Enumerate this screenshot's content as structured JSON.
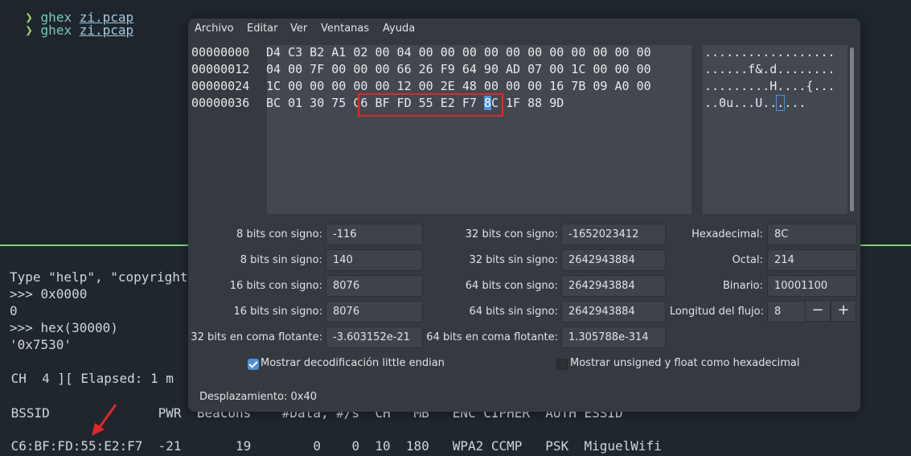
{
  "terminal": {
    "top_lines": [
      {
        "arrow": "❯",
        "cmd": "ghex",
        "file": "zi.pcap"
      }
    ],
    "partial_top_line": "❯ ghex zi.pcap",
    "python": [
      "Type \"help\", \"copyright\"",
      ">>> 0x0000",
      "0",
      ">>> hex(30000)",
      "'0x7530'"
    ],
    "airodump_status": " CH  4 ][ Elapsed: 1 m",
    "header_row": " BSSID              PWR  Beacons    #Data, #/s  CH   MB   ENC CIPHER  AUTH ESSID",
    "data_row": " C6:BF:FD:55:E2:F7  -21       19        0    0  10  180   WPA2 CCMP   PSK  MiguelWifi",
    "colors": {
      "prompt": "#9fd36f",
      "divider": "#7fd37a",
      "annotation": "#e2262a"
    }
  },
  "ghex": {
    "menu": [
      "Archivo",
      "Editar",
      "Ver",
      "Ventanas",
      "Ayuda"
    ],
    "rows": [
      {
        "offset": "00000000",
        "hex": "D4 C3 B2 A1 02 00 04 00 00 00 00 00 00 00 00 00 00 00",
        "ascii": ".................."
      },
      {
        "offset": "00000012",
        "hex": "04 00 7F 00 00 00 66 26 F9 64 90 AD 07 00 1C 00 00 00",
        "ascii": "......f&.d........"
      },
      {
        "offset": "00000024",
        "hex": "1C 00 00 00 00 00 12 00 2E 48 00 00 00 16 7B 09 A0 00",
        "ascii": ".........H....{..."
      },
      {
        "offset": "00000036",
        "hex_before": "BC 01 30 75 C6 BF FD 55 E2 F7 ",
        "hex_cursor": "8",
        "hex_after": "C 1F 88 9D",
        "ascii_before": "..0u...U..",
        "ascii_cursor": ".",
        "ascii_after": "..."
      }
    ],
    "fields": {
      "s8_label": "8 bits con signo:",
      "s8": "-116",
      "u8_label": "8 bits sin signo:",
      "u8": "140",
      "s16_label": "16 bits con signo:",
      "s16": "8076",
      "u16_label": "16 bits sin signo:",
      "u16": "8076",
      "f32_label": "32 bits en coma flotante:",
      "f32": "-3.603152e-21",
      "s32_label": "32 bits con signo:",
      "s32": "-1652023412",
      "u32_label": "32 bits sin signo:",
      "u32": "2642943884",
      "s64_label": "64 bits con signo:",
      "s64": "2642943884",
      "u64_label": "64 bits sin signo:",
      "u64": "2642943884",
      "f64_label": "64 bits en coma flotante:",
      "f64": "1.305788e-314",
      "hex_label": "Hexadecimal:",
      "hex": "8C",
      "oct_label": "Octal:",
      "oct": "214",
      "bin_label": "Binario:",
      "bin": "10001100",
      "stream_label": "Longitud del flujo:",
      "stream": "8"
    },
    "stepper": {
      "minus": "−",
      "plus": "+"
    },
    "checkboxes": {
      "little_endian": {
        "label": "Mostrar decodificación little endian",
        "checked": true
      },
      "unsigned_hex": {
        "label": "Mostrar unsigned y float como hexadecimal",
        "checked": false
      }
    },
    "status": "Desplazamiento: 0x40",
    "accent": "#4f8fd8"
  }
}
